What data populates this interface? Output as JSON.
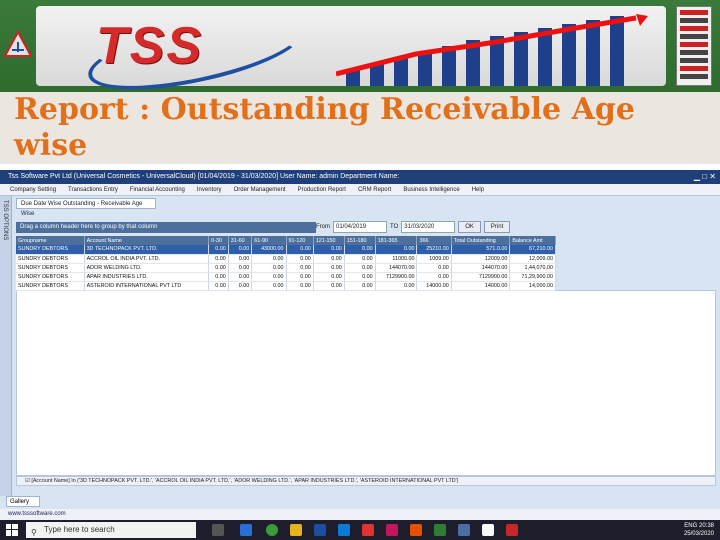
{
  "slide": {
    "logo_text": "TSS",
    "title": "Report : Outstanding Receivable Age wise"
  },
  "app": {
    "window_title": "Tss Software Pvt Ltd (Universal Cosmetics - UniversalCloud) [01/04/2019 - 31/03/2020] User Name: admin Department Name:",
    "menu": [
      "Company Setting",
      "Transactions Entry",
      "Financial Accounting",
      "Inventory",
      "Order Management",
      "Production Report",
      "CRM Report",
      "Business Intelligence",
      "Help"
    ],
    "side_tab": "TSS OPTIONS",
    "doc_tab": "Due Date Wise Outstanding - Receivable Age Wise",
    "group_hint": "Drag a column header here to group by that column",
    "from_label": "From",
    "from_date": "01/04/2019",
    "to_label": "TO",
    "to_date": "31/03/2020",
    "ok_label": "OK",
    "print_label": "Print",
    "columns": [
      "Groupname",
      "Account Name",
      "0-30",
      "31-60",
      "61-90",
      "91-120",
      "121-150",
      "151-180",
      "181-365",
      "366",
      "Total Outstanding",
      "Balance Amt"
    ],
    "rows": [
      [
        "SUNDRY DEBTORS",
        "3D TECHNOPACK PVT. LTD.",
        "0.00",
        "0.00",
        "43000.00",
        "0.00",
        "0.00",
        "0.00",
        "0.00",
        "25210.00",
        "571.0.00",
        "67,210.00"
      ],
      [
        "SUNDRY DEBTORS",
        "ACCROL OIL INDIA PVT. LTD.",
        "0.00",
        "0.00",
        "0.00",
        "0.00",
        "0.00",
        "0.00",
        "11000.00",
        "1009.00",
        "12009.00",
        "12,009.00"
      ],
      [
        "SUNDRY DEBTORS",
        "ADOR WELDING LTD.",
        "0.00",
        "0.00",
        "0.00",
        "0.00",
        "0.00",
        "0.00",
        "144070.00",
        "0.00",
        "144070.00",
        "1,44,070.00"
      ],
      [
        "SUNDRY DEBTORS",
        "APAR INDUSTRIES LTD.",
        "0.00",
        "0.00",
        "0.00",
        "0.00",
        "0.00",
        "0.00",
        "7129900.00",
        "0.00",
        "7129900.00",
        "71,29,900.00"
      ],
      [
        "SUNDRY DEBTORS",
        "ASTEROID INTERNATIONAL PVT LTD",
        "0.00",
        "0.00",
        "0.00",
        "0.00",
        "0.00",
        "0.00",
        "0.00",
        "14000.00",
        "14000.00",
        "14,000.00"
      ]
    ],
    "filter_text": "[Account Name] In ('3D TECHNOPACK PVT. LTD.', 'ACCROL OIL INDIA PVT. LTD.', 'ADOR WELDING LTD.', 'APAR INDUSTRIES LTD.', 'ASTEROID INTERNATIONAL PVT LTD')",
    "bottom_tab": "Gallery",
    "status_url": "www.tsssoftware.com"
  },
  "taskbar": {
    "search_placeholder": "Type here to search",
    "lang": "ENG",
    "time": "20:38",
    "date": "25/03/2020"
  }
}
